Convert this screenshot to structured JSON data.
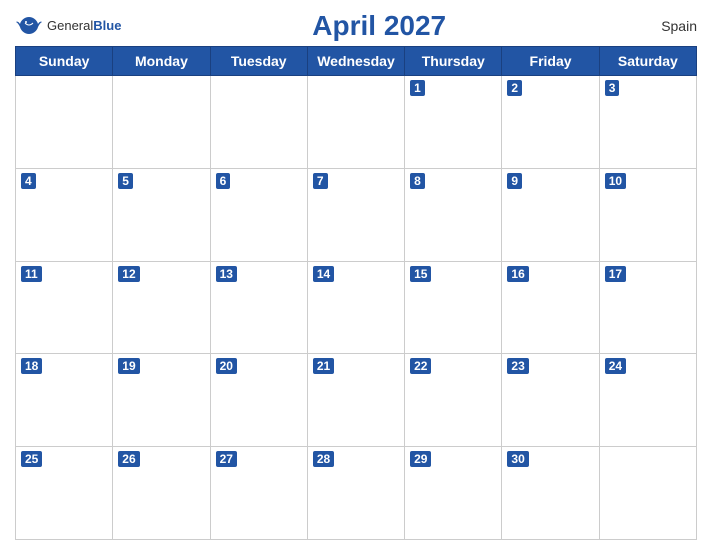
{
  "header": {
    "logo_general": "General",
    "logo_blue": "Blue",
    "title": "April 2027",
    "country": "Spain"
  },
  "days": [
    "Sunday",
    "Monday",
    "Tuesday",
    "Wednesday",
    "Thursday",
    "Friday",
    "Saturday"
  ],
  "weeks": [
    [
      null,
      null,
      null,
      null,
      1,
      2,
      3
    ],
    [
      4,
      5,
      6,
      7,
      8,
      9,
      10
    ],
    [
      11,
      12,
      13,
      14,
      15,
      16,
      17
    ],
    [
      18,
      19,
      20,
      21,
      22,
      23,
      24
    ],
    [
      25,
      26,
      27,
      28,
      29,
      30,
      null
    ]
  ]
}
